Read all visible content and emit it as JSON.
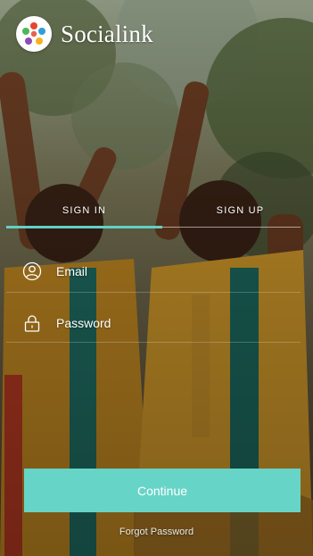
{
  "app": {
    "title": "Socialink",
    "logo_icon": "socialink-logo"
  },
  "tabs": [
    {
      "label": "SIGN IN",
      "active": true
    },
    {
      "label": "SIGN UP",
      "active": false
    }
  ],
  "form": {
    "email": {
      "label": "Email",
      "icon": "user-icon"
    },
    "password": {
      "label": "Password",
      "icon": "lock-icon"
    }
  },
  "actions": {
    "continue_label": "Continue",
    "forgot_label": "Forgot Password"
  },
  "colors": {
    "accent": "#67d4c8",
    "text": "#ffffff"
  }
}
